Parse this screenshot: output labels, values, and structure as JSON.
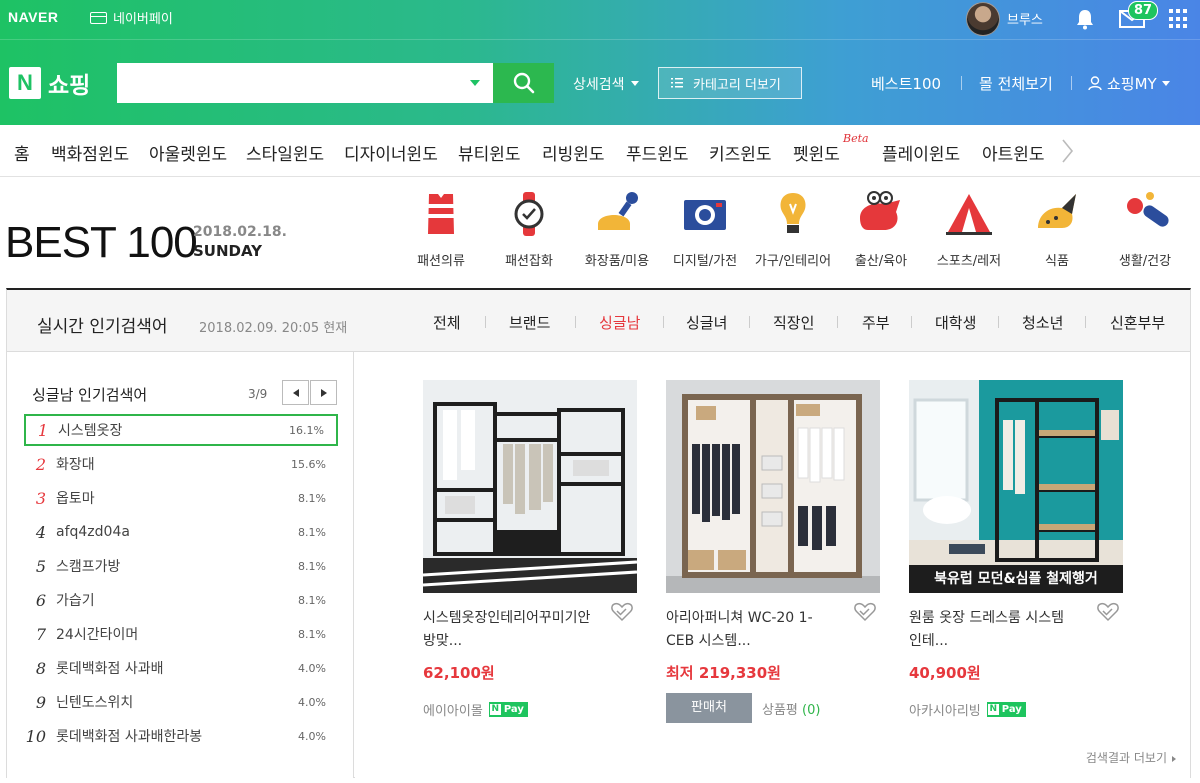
{
  "header": {
    "naver_logo": "NAVER",
    "naverpay_label": "네이버페이",
    "user_name": "브루스",
    "mail_count": "87",
    "shopping_logo_badge": "N",
    "shopping_logo_text": "쇼핑",
    "search_placeholder": "",
    "advanced_search": "상세검색",
    "category_more": "카테고리 더보기",
    "best100_link": "베스트100",
    "all_malls_link": "몰 전체보기",
    "my_shopping": "쇼핑MY"
  },
  "window_nav": {
    "items": [
      "홈",
      "백화점윈도",
      "아울렛윈도",
      "스타일윈도",
      "디자이너윈도",
      "뷰티윈도",
      "리빙윈도",
      "푸드윈도",
      "키즈윈도",
      "펫윈도",
      "플레이윈도",
      "아트윈도"
    ],
    "beta_label": "Beta"
  },
  "best100": {
    "title": "BEST 100",
    "date": "2018.02.18.",
    "day": "SUNDAY",
    "categories": [
      {
        "label": "패션의류",
        "icon": "clothing-icon"
      },
      {
        "label": "패션잡화",
        "icon": "watch-icon"
      },
      {
        "label": "화장품/미용",
        "icon": "cosmetics-icon"
      },
      {
        "label": "디지털/가전",
        "icon": "camera-icon"
      },
      {
        "label": "가구/인테리어",
        "icon": "lightbulb-icon"
      },
      {
        "label": "출산/육아",
        "icon": "toy-icon"
      },
      {
        "label": "스포츠/레저",
        "icon": "tent-icon"
      },
      {
        "label": "식품",
        "icon": "food-icon"
      },
      {
        "label": "생활/건강",
        "icon": "pills-icon"
      }
    ]
  },
  "realtime": {
    "title": "실시간 인기검색어",
    "timestamp": "2018.02.09. 20:05 현재",
    "tabs": [
      "전체",
      "브랜드",
      "싱글남",
      "싱글녀",
      "직장인",
      "주부",
      "대학생",
      "청소년",
      "신혼부부"
    ],
    "active_tab": "싱글남",
    "list_title": "싱글남 인기검색어",
    "page": "3/9",
    "ranks": [
      {
        "num": "1",
        "term": "시스템옷장",
        "pct": "16.1%"
      },
      {
        "num": "2",
        "term": "화장대",
        "pct": "15.6%"
      },
      {
        "num": "3",
        "term": "옵토마",
        "pct": "8.1%"
      },
      {
        "num": "4",
        "term": "afq4zd04a",
        "pct": "8.1%"
      },
      {
        "num": "5",
        "term": "스캠프가방",
        "pct": "8.1%"
      },
      {
        "num": "6",
        "term": "가습기",
        "pct": "8.1%"
      },
      {
        "num": "7",
        "term": "24시간타이머",
        "pct": "8.1%"
      },
      {
        "num": "8",
        "term": "롯데백화점 사과배",
        "pct": "4.0%"
      },
      {
        "num": "9",
        "term": "닌텐도스위치",
        "pct": "4.0%"
      },
      {
        "num": "10",
        "term": "롯데백화점 사과배한라봉",
        "pct": "4.0%"
      }
    ],
    "products": [
      {
        "name": "시스템옷장인테리어꾸미기안방맞...",
        "price": "62,100원",
        "seller": "에이아이몰",
        "npay": "Pay"
      },
      {
        "name": "아리아퍼니쳐 WC-20 1-CEB 시스템...",
        "price": "최저 219,330원",
        "seller_button": "판매처",
        "review_label": "상품평",
        "review_count": "(0)"
      },
      {
        "name": "원룸 옷장 드레스룸 시스템 인테...",
        "price": "40,900원",
        "seller": "아카시아리빙",
        "npay": "Pay",
        "banner": "북유럽 모던&심플 철제행거"
      }
    ],
    "more_results": "검색결과 더보기"
  },
  "colors": {
    "accent_green": "#1ec264",
    "price_red": "#e6383d",
    "naverpay_green": "#1ec45e"
  }
}
